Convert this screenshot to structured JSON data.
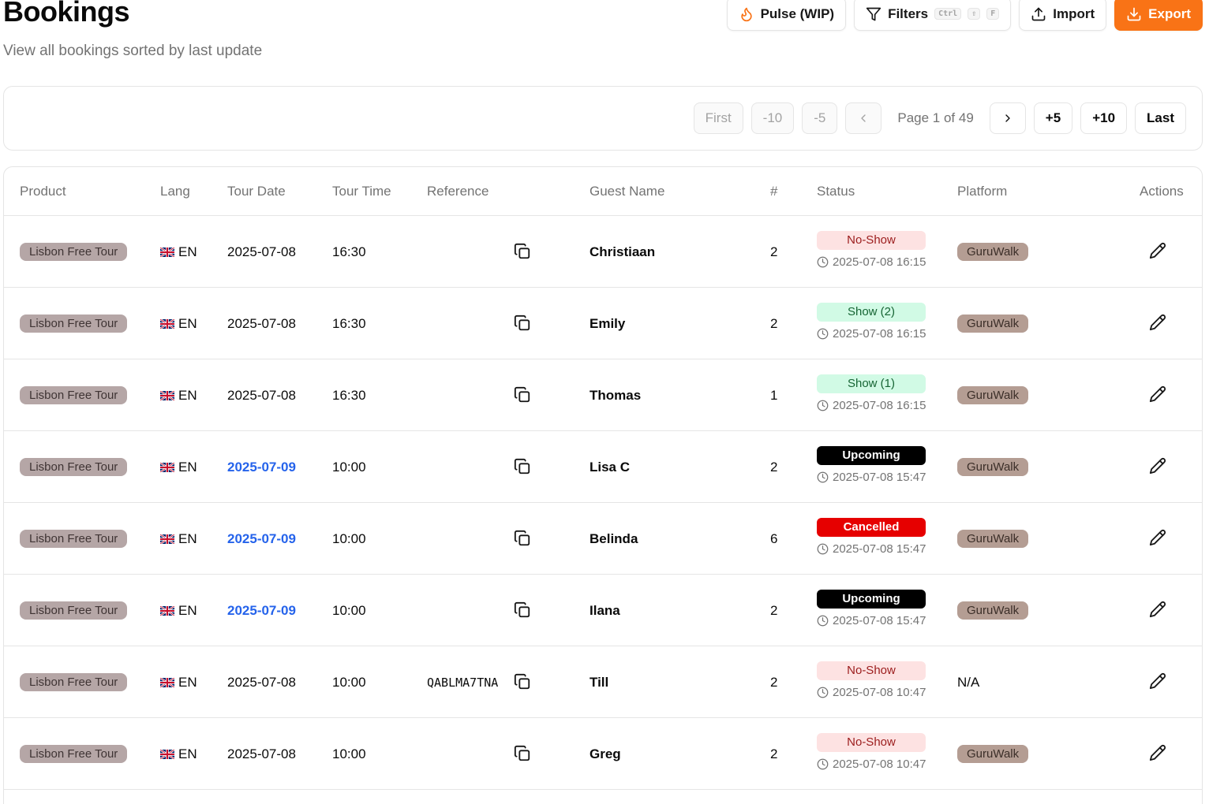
{
  "header": {
    "title": "Bookings",
    "subtitle": "View all bookings sorted by last update"
  },
  "toolbar": {
    "pulse_label": "Pulse (WIP)",
    "filters_label": "Filters",
    "filters_kbd": [
      "Ctrl",
      "⇧",
      "F"
    ],
    "import_label": "Import",
    "export_label": "Export",
    "accent_color": "#f97316"
  },
  "pagination": {
    "first": "First",
    "minus10": "-10",
    "minus5": "-5",
    "page_label": "Page 1 of 49",
    "plus5": "+5",
    "plus10": "+10",
    "last": "Last"
  },
  "table": {
    "columns": [
      "Product",
      "Lang",
      "Tour Date",
      "Tour Time",
      "Reference",
      "Guest Name",
      "#",
      "Status",
      "Platform",
      "Actions"
    ],
    "rows": [
      {
        "product": "Lisbon Free Tour",
        "lang": "EN",
        "date": "2025-07-08",
        "date_link": false,
        "time": "16:30",
        "reference": "",
        "guest": "Christiaan",
        "count": "2",
        "status": "No-Show",
        "status_type": "noshow",
        "updated": "2025-07-08 16:15",
        "platform": "GuruWalk"
      },
      {
        "product": "Lisbon Free Tour",
        "lang": "EN",
        "date": "2025-07-08",
        "date_link": false,
        "time": "16:30",
        "reference": "",
        "guest": "Emily",
        "count": "2",
        "status": "Show (2)",
        "status_type": "show",
        "updated": "2025-07-08 16:15",
        "platform": "GuruWalk"
      },
      {
        "product": "Lisbon Free Tour",
        "lang": "EN",
        "date": "2025-07-08",
        "date_link": false,
        "time": "16:30",
        "reference": "",
        "guest": "Thomas",
        "count": "1",
        "status": "Show (1)",
        "status_type": "show",
        "updated": "2025-07-08 16:15",
        "platform": "GuruWalk"
      },
      {
        "product": "Lisbon Free Tour",
        "lang": "EN",
        "date": "2025-07-09",
        "date_link": true,
        "time": "10:00",
        "reference": "",
        "guest": "Lisa C",
        "count": "2",
        "status": "Upcoming",
        "status_type": "upcoming",
        "updated": "2025-07-08 15:47",
        "platform": "GuruWalk"
      },
      {
        "product": "Lisbon Free Tour",
        "lang": "EN",
        "date": "2025-07-09",
        "date_link": true,
        "time": "10:00",
        "reference": "",
        "guest": "Belinda",
        "count": "6",
        "status": "Cancelled",
        "status_type": "cancelled",
        "updated": "2025-07-08 15:47",
        "platform": "GuruWalk"
      },
      {
        "product": "Lisbon Free Tour",
        "lang": "EN",
        "date": "2025-07-09",
        "date_link": true,
        "time": "10:00",
        "reference": "",
        "guest": "Ilana",
        "count": "2",
        "status": "Upcoming",
        "status_type": "upcoming",
        "updated": "2025-07-08 15:47",
        "platform": "GuruWalk"
      },
      {
        "product": "Lisbon Free Tour",
        "lang": "EN",
        "date": "2025-07-08",
        "date_link": false,
        "time": "10:00",
        "reference": "QABLMA7TNA",
        "guest": "Till",
        "count": "2",
        "status": "No-Show",
        "status_type": "noshow",
        "updated": "2025-07-08 10:47",
        "platform": "N/A"
      },
      {
        "product": "Lisbon Free Tour",
        "lang": "EN",
        "date": "2025-07-08",
        "date_link": false,
        "time": "10:00",
        "reference": "",
        "guest": "Greg",
        "count": "2",
        "status": "No-Show",
        "status_type": "noshow",
        "updated": "2025-07-08 10:47",
        "platform": "GuruWalk"
      }
    ]
  }
}
